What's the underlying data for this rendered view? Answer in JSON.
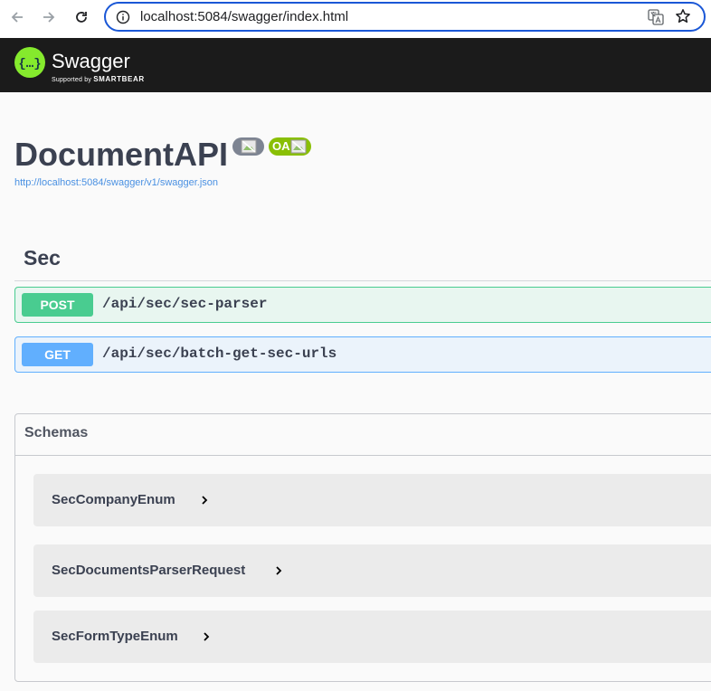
{
  "browser": {
    "url": "localhost:5084/swagger/index.html"
  },
  "topbar": {
    "brand": "Swagger",
    "supported_by": "Supported by",
    "smartbear": "SMARTBEAR",
    "accent": "#85ea2d"
  },
  "info": {
    "title": "DocumentAPI",
    "oas_badge": "OA",
    "spec_url": "http://localhost:5084/swagger/v1/swagger.json"
  },
  "tag": {
    "name": "Sec"
  },
  "operations": [
    {
      "method": "POST",
      "path": "/api/sec/sec-parser",
      "color": "#49cc90"
    },
    {
      "method": "GET",
      "path": "/api/sec/batch-get-sec-urls",
      "color": "#61affe"
    }
  ],
  "schemas": {
    "title": "Schemas",
    "models": [
      {
        "name": "SecCompanyEnum"
      },
      {
        "name": "SecDocumentsParserRequest"
      },
      {
        "name": "SecFormTypeEnum"
      }
    ]
  }
}
